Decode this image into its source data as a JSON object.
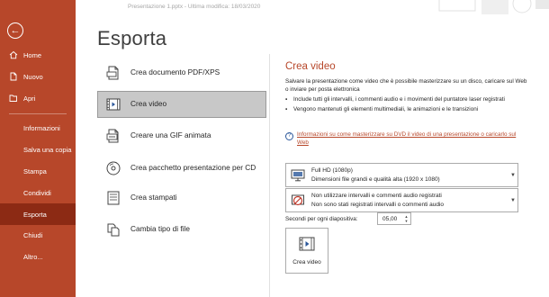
{
  "window": {
    "title": "Presentazione 1.pptx  -  Ultima modifica: 18/03/2020"
  },
  "colors": {
    "brand": "#b7472a",
    "sidebar_active": "#8c2a14",
    "selected_option": "#c8c8c8",
    "link": "#b7472a"
  },
  "sidebar": {
    "back_icon": "back-arrow-icon",
    "items": [
      {
        "label": "Home",
        "icon": "home-icon"
      },
      {
        "label": "Nuovo",
        "icon": "new-document-icon"
      },
      {
        "label": "Apri",
        "icon": "open-folder-icon"
      },
      {
        "label": "Informazioni"
      },
      {
        "label": "Salva una copia"
      },
      {
        "label": "Stampa"
      },
      {
        "label": "Condividi"
      },
      {
        "label": "Esporta",
        "active": true
      },
      {
        "label": "Chiudi"
      },
      {
        "label": "Altro..."
      }
    ]
  },
  "main": {
    "title": "Esporta",
    "options": [
      {
        "label": "Crea documento PDF/XPS",
        "icon": "pdf-document-icon"
      },
      {
        "label": "Crea video",
        "icon": "video-film-icon",
        "selected": true
      },
      {
        "label": "Creare una GIF animata",
        "icon": "gif-icon"
      },
      {
        "label": "Crea pacchetto presentazione per CD",
        "icon": "cd-package-icon"
      },
      {
        "label": "Crea stampati",
        "icon": "handouts-icon"
      },
      {
        "label": "Cambia tipo di file",
        "icon": "change-file-type-icon"
      }
    ]
  },
  "video_panel": {
    "title": "Crea video",
    "description": "Salvare la presentazione come video che è possibile masterizzare su un disco, caricare sul Web o inviare per posta elettronica",
    "bullets": [
      "Include tutti gli intervalli, i commenti audio e i movimenti del puntatore laser registrati",
      "Vengono mantenuti gli elementi multimediali, le animazioni e le transizioni"
    ],
    "help_link": "Informazioni su come masterizzare su DVD il video di una presentazione o caricarlo sul Web",
    "quality_dropdown": {
      "value": "Full HD (1080p)",
      "detail": "Dimensioni file grandi e qualità alta (1920 x 1080)"
    },
    "timings_dropdown": {
      "value": "Non utilizzare intervalli e commenti audio registrati",
      "detail": "Non sono stati registrati intervalli o commenti audio"
    },
    "seconds_label": "Secondi per ogni diapositiva:",
    "seconds_value": "05,00",
    "create_button": "Crea video"
  }
}
